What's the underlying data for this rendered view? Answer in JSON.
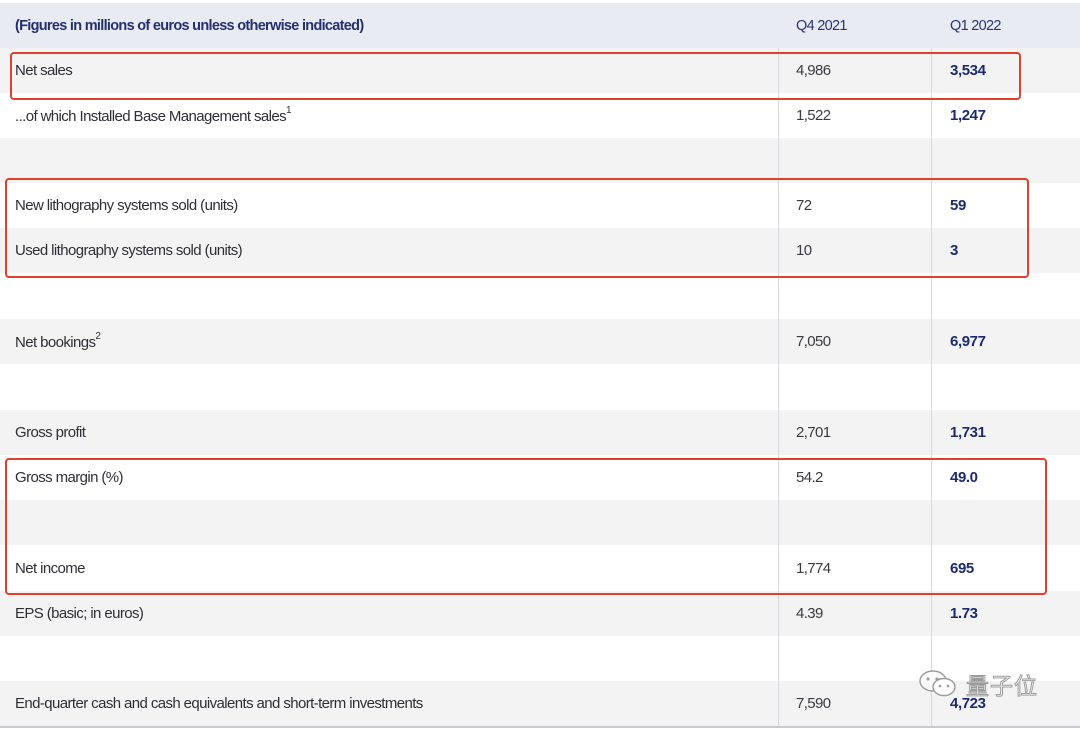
{
  "header": {
    "label": "(Figures in millions of euros unless otherwise indicated)",
    "col_q4": "Q4 2021",
    "col_q1": "Q1 2022"
  },
  "rows": [
    {
      "label": "Net sales",
      "sup": "",
      "q4": "4,986",
      "q1": "3,534"
    },
    {
      "label": "...of which Installed Base Management sales",
      "sup": "1",
      "q4": "1,522",
      "q1": "1,247"
    },
    {
      "label": "",
      "sup": "",
      "q4": "",
      "q1": ""
    },
    {
      "label": "New lithography systems sold (units)",
      "sup": "",
      "q4": "72",
      "q1": "59"
    },
    {
      "label": "Used lithography systems sold (units)",
      "sup": "",
      "q4": "10",
      "q1": "3"
    },
    {
      "label": "",
      "sup": "",
      "q4": "",
      "q1": ""
    },
    {
      "label": "Net bookings",
      "sup": "2",
      "q4": "7,050",
      "q1": "6,977"
    },
    {
      "label": "",
      "sup": "",
      "q4": "",
      "q1": ""
    },
    {
      "label": "Gross profit",
      "sup": "",
      "q4": "2,701",
      "q1": "1,731"
    },
    {
      "label": "Gross margin (%)",
      "sup": "",
      "q4": "54.2",
      "q1": "49.0"
    },
    {
      "label": "",
      "sup": "",
      "q4": "",
      "q1": ""
    },
    {
      "label": "Net income",
      "sup": "",
      "q4": "1,774",
      "q1": "695"
    },
    {
      "label": "EPS (basic; in euros)",
      "sup": "",
      "q4": "4.39",
      "q1": "1.73"
    },
    {
      "label": "",
      "sup": "",
      "q4": "",
      "q1": ""
    },
    {
      "label": "End-quarter cash and cash equivalents and short-term investments",
      "sup": "",
      "q4": "7,590",
      "q1": "4,723"
    }
  ],
  "watermark": {
    "text": "量子位",
    "icon": "wechat-icon"
  },
  "colors": {
    "highlight": "#e2402c",
    "header_bg": "#e9ebf3",
    "shade_bg": "#f3f3f3",
    "q1_text": "#1c2a6e"
  }
}
